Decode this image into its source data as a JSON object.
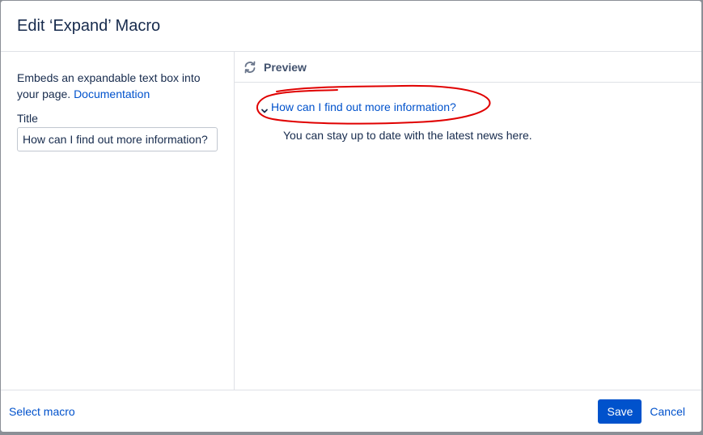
{
  "dialog": {
    "title": "Edit ‘Expand’ Macro"
  },
  "left_panel": {
    "description": "Embeds an expandable text box into your page.",
    "documentation_link": "Documentation",
    "title_label": "Title",
    "title_value": "How can I find out more information?"
  },
  "preview": {
    "header_label": "Preview",
    "header_icon": "refresh-icon",
    "expand_title": "How can I find out more information?",
    "expand_icon": "chevron-down-icon",
    "expand_body": "You can stay up to date with the latest news here.",
    "annotation_color": "#e00000"
  },
  "footer": {
    "select_macro": "Select macro",
    "save_label": "Save",
    "cancel_label": "Cancel"
  },
  "colors": {
    "accent": "#0052cc",
    "text": "#172b4d",
    "overlay": "#8b8f96"
  }
}
